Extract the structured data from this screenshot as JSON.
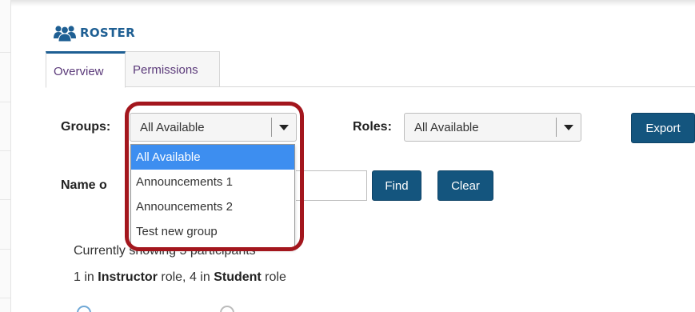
{
  "header": {
    "title": "ROSTER",
    "icon": "users-icon",
    "accent_color": "#1e5f93"
  },
  "tabs": [
    {
      "label": "Overview",
      "active": true
    },
    {
      "label": "Permissions",
      "active": false
    }
  ],
  "filters": {
    "groups_label": "Groups:",
    "groups_value": "All Available",
    "roles_label": "Roles:",
    "roles_value": "All Available",
    "export_label": "Export",
    "name_label_partial": "Name o",
    "find_label": "Find",
    "clear_label": "Clear"
  },
  "groups_dropdown": {
    "options": [
      "All Available",
      "Announcements 1",
      "Announcements 2",
      "Test new group"
    ],
    "selected_index": 0,
    "highlight_color": "#a3161d"
  },
  "summary": {
    "partial_line": "Currently showing 5 participants",
    "counts_prefix": "1 in ",
    "instructor_role": "Instructor",
    "counts_middle": " role, 4 in ",
    "student_role": "Student",
    "counts_suffix": " role"
  },
  "colors": {
    "button": "#14557e",
    "tab_text": "#5b3a7a",
    "selected_option": "#3d8ef0"
  }
}
